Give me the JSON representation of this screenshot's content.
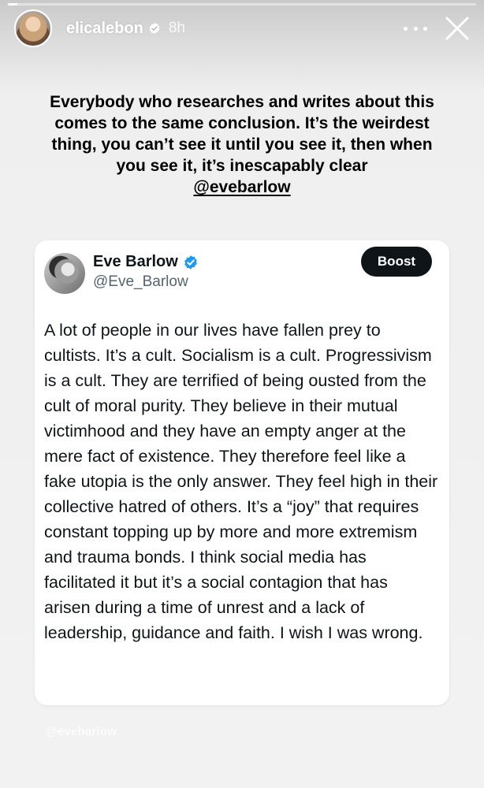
{
  "story": {
    "progress_fraction": 0.02,
    "username": "elicalebon",
    "timestamp": "8h",
    "icons": {
      "avatar": "avatar",
      "verified": "verified-badge-icon",
      "more": "more-options-icon",
      "close": "close-icon"
    }
  },
  "caption": {
    "text": "Everybody who researches and writes about this comes to the same conclusion. It’s the weirdest thing, you can’t see it until you see it, then when you see it, it’s inescapably clear",
    "mention": "@evebarlow"
  },
  "tweet": {
    "name": "Eve Barlow",
    "handle": "@Eve_Barlow",
    "boost_label": "Boost",
    "body": "A lot of people in our lives have fallen prey to cultists. It’s a cult. Socialism is a cult. Progressivism is a cult. They are terrified of being ousted from the cult of moral purity. They believe in their mutual victimhood and they have an empty anger at the mere fact of existence. They therefore feel like a fake utopia is the only answer. They feel high in their collective hatred of others. It’s a “joy” that requires constant topping up by more and more extremism and trauma bonds. I think social media has facilitated it but it’s a social contagion that has arisen during a time of unrest and a lack of leadership, guidance and faith. I wish I was wrong."
  },
  "watermark": "@evebarlow",
  "colors": {
    "verified": "#1d9bf0",
    "button_bg": "#0f1419",
    "handle": "#536471"
  }
}
